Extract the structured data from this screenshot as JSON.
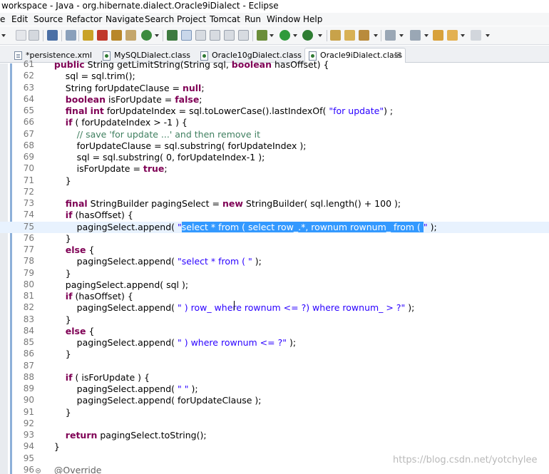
{
  "window": {
    "title": "workspace - Java - org.hibernate.dialect.Oracle9iDialect - Eclipse"
  },
  "menu": {
    "items": [
      "File",
      "Edit",
      "Source",
      "Refactor",
      "Navigate",
      "Search",
      "Project",
      "Tomcat",
      "Run",
      "Window",
      "Help"
    ],
    "first_item_visible": "e"
  },
  "toolbar": {
    "icons": [
      "new-icon",
      "save-icon",
      "save-all-icon",
      "print-icon",
      "open-type-icon",
      "debug-icon",
      "run-icon",
      "external-tools-icon",
      "search-icon",
      "back-icon",
      "forward-icon"
    ]
  },
  "tabs": [
    {
      "label": "*persistence.xml",
      "type": "xml",
      "active": false
    },
    {
      "label": "MySQLDialect.class",
      "type": "class",
      "active": false
    },
    {
      "label": "Oracle10gDialect.class",
      "type": "class",
      "active": false
    },
    {
      "label": "Oracle9iDialect.class",
      "type": "class",
      "active": true,
      "close": "☒"
    }
  ],
  "editor": {
    "lines": [
      {
        "n": "61",
        "t": "    public String getLimitString(String sql, boolean hasOffset) {"
      },
      {
        "n": "62",
        "t": "        sql = sql.trim();"
      },
      {
        "n": "63",
        "t": "        String forUpdateClause = null;"
      },
      {
        "n": "64",
        "t": "        boolean isForUpdate = false;"
      },
      {
        "n": "65",
        "t": "        final int forUpdateIndex = sql.toLowerCase().lastIndexOf( \"for update\") ;"
      },
      {
        "n": "66",
        "t": "        if ( forUpdateIndex > -1 ) {"
      },
      {
        "n": "67",
        "t": "            // save 'for update ...' and then remove it"
      },
      {
        "n": "68",
        "t": "            forUpdateClause = sql.substring( forUpdateIndex );"
      },
      {
        "n": "69",
        "t": "            sql = sql.substring( 0, forUpdateIndex-1 );"
      },
      {
        "n": "70",
        "t": "            isForUpdate = true;"
      },
      {
        "n": "71",
        "t": "        }"
      },
      {
        "n": "72",
        "t": ""
      },
      {
        "n": "73",
        "t": "        final StringBuilder pagingSelect = new StringBuilder( sql.length() + 100 );"
      },
      {
        "n": "74",
        "t": "        if (hasOffset) {"
      },
      {
        "n": "75",
        "t": "            pagingSelect.append( \"select * from ( select row_.*, rownum rownum_ from ( \" );"
      },
      {
        "n": "76",
        "t": "        }"
      },
      {
        "n": "77",
        "t": "        else {"
      },
      {
        "n": "78",
        "t": "            pagingSelect.append( \"select * from ( \" );"
      },
      {
        "n": "79",
        "t": "        }"
      },
      {
        "n": "80",
        "t": "        pagingSelect.append( sql );"
      },
      {
        "n": "81",
        "t": "        if (hasOffset) {"
      },
      {
        "n": "82",
        "t": "            pagingSelect.append( \" ) row_ where rownum <= ?) where rownum_ > ?\" );"
      },
      {
        "n": "83",
        "t": "        }"
      },
      {
        "n": "84",
        "t": "        else {"
      },
      {
        "n": "85",
        "t": "            pagingSelect.append( \" ) where rownum <= ?\" );"
      },
      {
        "n": "86",
        "t": "        }"
      },
      {
        "n": "87",
        "t": ""
      },
      {
        "n": "88",
        "t": "        if ( isForUpdate ) {"
      },
      {
        "n": "89",
        "t": "            pagingSelect.append( \" \" );"
      },
      {
        "n": "90",
        "t": "            pagingSelect.append( forUpdateClause );"
      },
      {
        "n": "91",
        "t": "        }"
      },
      {
        "n": "92",
        "t": ""
      },
      {
        "n": "93",
        "t": "        return pagingSelect.toString();"
      },
      {
        "n": "94",
        "t": "    }"
      },
      {
        "n": "95",
        "t": ""
      },
      {
        "n": "96",
        "t": "    @Override"
      }
    ],
    "current_line": "75",
    "selection": {
      "line": "75",
      "text": "select * from ( select row_.*, rownum rownum_ from ( "
    }
  },
  "watermark": "https://blog.csdn.net/yotchylee",
  "colors": {
    "keyword": "#7f0055",
    "string": "#2a00ff",
    "comment": "#3f7f5f",
    "selection": "#3399ff",
    "current_line": "#e8f2fe"
  }
}
